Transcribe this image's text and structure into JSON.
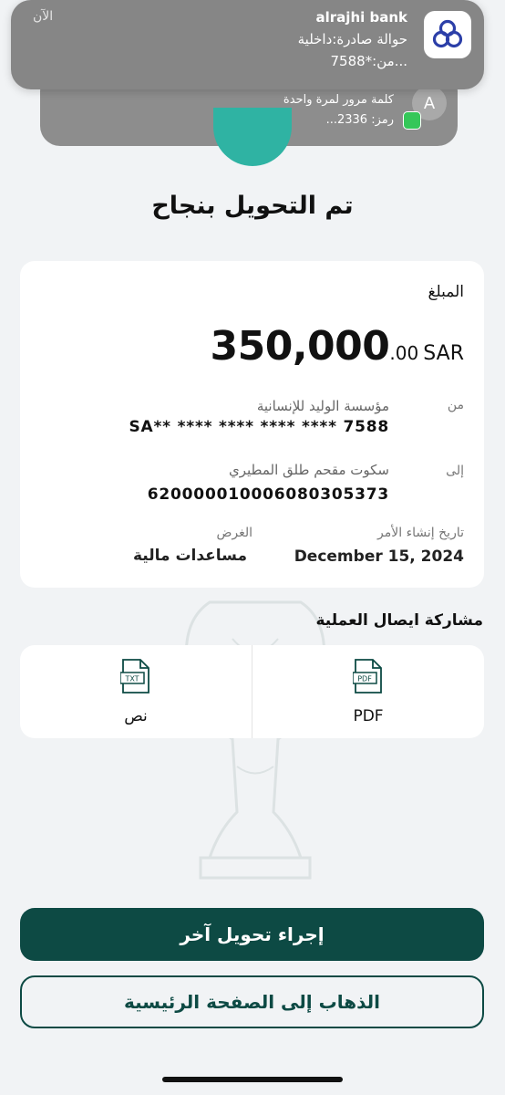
{
  "notification_main": {
    "app": "alrajhi bank",
    "time": "الآن",
    "line1": "حوالة صادرة:داخلية",
    "line2": "من:*7588..."
  },
  "notification_secondary": {
    "avatar_letter": "A",
    "line1": "كلمة مرور لمرة واحدة",
    "line2": "رمز: 2336..."
  },
  "title": "تم التحويل بنجاح",
  "transfer": {
    "amount_label": "المبلغ",
    "amount_integer": "350,000",
    "amount_decimal": ".00",
    "currency": "SAR",
    "from_label": "من",
    "from_name": "مؤسسة الوليد للإنسانية",
    "from_account": "SA** **** **** **** **** 7588",
    "to_label": "إلى",
    "to_name": "سكوت مقحم طلق المطيري",
    "to_account": "620000010006080305373",
    "date_label": "تاريخ إنشاء الأمر",
    "date_value": "December 15, 2024",
    "purpose_label": "الغرض",
    "purpose_value": "مساعدات مالية"
  },
  "share": {
    "title": "مشاركة ايصال العملية",
    "pdf_label": "PDF",
    "pdf_icon_text": "PDF",
    "text_label": "نص",
    "text_icon_text": "TXT"
  },
  "buttons": {
    "new_transfer": "إجراء تحويل آخر",
    "go_home": "الذهاب إلى الصفحة الرئيسية"
  },
  "colors": {
    "primary": "#0d4a44",
    "accent": "#2fb3a3",
    "background": "#f1f3f5"
  }
}
